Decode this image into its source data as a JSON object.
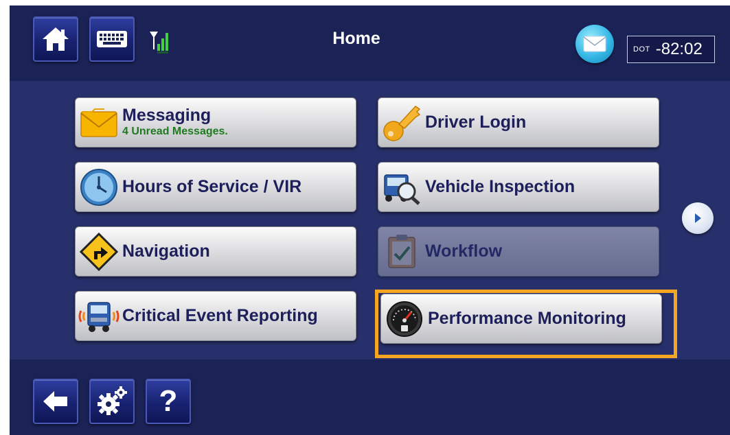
{
  "header": {
    "title": "Home",
    "home_icon": "home-icon",
    "keyboard_icon": "keyboard-icon",
    "signal_icon": "signal-strength-icon",
    "message_icon": "envelope-icon",
    "dot_label": "DOT",
    "dot_clock": "-82:02"
  },
  "menu": {
    "messaging": {
      "label": "Messaging",
      "sublabel": "4 Unread Messages.",
      "icon": "envelope-icon"
    },
    "driver_login": {
      "label": "Driver Login",
      "icon": "key-icon"
    },
    "hours_of_service": {
      "label": "Hours of Service / VIR",
      "icon": "clock-icon"
    },
    "vehicle_inspection": {
      "label": "Vehicle Inspection",
      "icon": "truck-magnifier-icon"
    },
    "navigation": {
      "label": "Navigation",
      "icon": "turn-sign-icon"
    },
    "workflow": {
      "label": "Workflow",
      "icon": "clipboard-icon",
      "enabled": false
    },
    "critical_event": {
      "label": "Critical Event Reporting",
      "icon": "truck-alert-icon"
    },
    "performance_monitoring": {
      "label": "Performance Monitoring",
      "icon": "gauge-icon",
      "highlighted": true
    }
  },
  "next_page_icon": "chevron-right-icon",
  "footer": {
    "back_icon": "back-arrow-icon",
    "settings_icon": "gears-icon",
    "help_label": "?"
  },
  "colors": {
    "background": "#27306a",
    "bar": "#1b2256",
    "highlight": "#f5a623",
    "unread_text": "#1f7a1f",
    "button_text": "#1d1f5a"
  }
}
